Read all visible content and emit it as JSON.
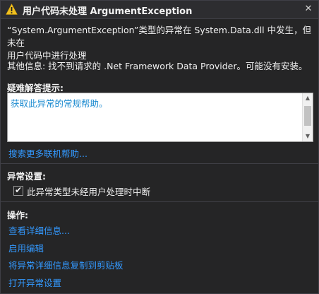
{
  "window": {
    "title": "用户代码未处理 ArgumentException",
    "icon": "warning-icon",
    "close_glyph": "✕"
  },
  "message": {
    "line1": "“System.ArgumentException”类型的异常在 System.Data.dll 中发生，但未在",
    "line2": "用户代码中进行处理",
    "additional_info": "其他信息: 找不到请求的 .Net Framework Data Provider。可能没有安装。"
  },
  "troubleshooting": {
    "heading": "疑难解答提示:",
    "tip_link": "获取此异常的常规帮助。",
    "search_online": "搜索更多联机帮助..."
  },
  "exception_settings": {
    "heading": "异常设置:",
    "break_when_unhandled": {
      "checked": true,
      "label": "此异常类型未经用户处理时中断"
    }
  },
  "actions": {
    "heading": "操作:",
    "items": [
      "查看详细信息...",
      "启用编辑",
      "将异常详细信息复制到剪贴板",
      "打开异常设置"
    ]
  },
  "colors": {
    "background": "#252526",
    "link": "#3399ff",
    "warning": "#f0c020"
  }
}
